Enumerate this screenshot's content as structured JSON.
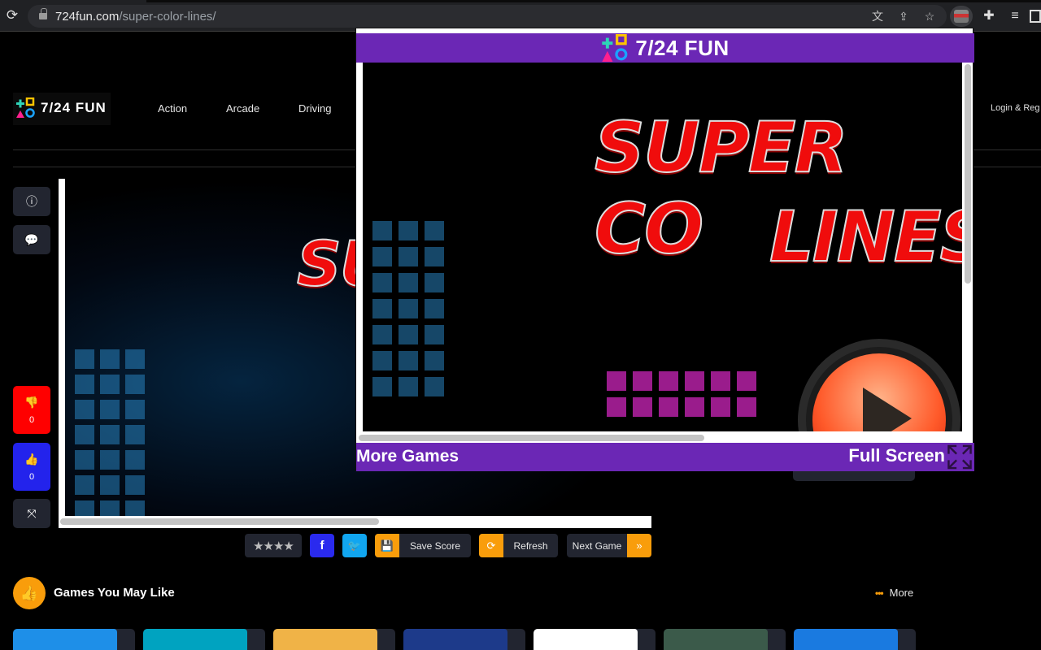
{
  "browser": {
    "url_host": "724fun.com",
    "url_path": "/super-color-lines/",
    "icons": [
      "reload-icon",
      "lock-icon",
      "translate-icon",
      "share-icon",
      "bookmark-star-icon",
      "extension-screenshot-icon",
      "extensions-puzzle-icon",
      "media-queue-icon"
    ]
  },
  "site": {
    "logo_text": "7/24 FUN",
    "nav": [
      "Action",
      "Arcade",
      "Driving"
    ],
    "login_label": "Login & Reg"
  },
  "side_actions": {
    "info_icon": "info-icon",
    "comment_icon": "comment-icon",
    "dislike_count": "0",
    "like_count": "0",
    "fullscreen_icon": "expand-icon",
    "dislike_color": "#ff0000",
    "like_color": "#2323ec"
  },
  "game": {
    "title_line1": "SUPER CO",
    "title_line2": "LINES",
    "bg_title_fragment": "SU"
  },
  "toolbar": {
    "rating_stars": "★★★★",
    "facebook_label": "f",
    "twitter_label": "🐦",
    "save_score_label": "Save Score",
    "refresh_label": "Refresh",
    "next_game_label": "Next Game",
    "next_icon": "»",
    "accent": "#f99d0b"
  },
  "popup": {
    "header_title": "7/24 FUN",
    "more_games_label": "More Games",
    "full_screen_label": "Full Screen",
    "purple": "#6b27b5"
  },
  "games_section": {
    "title": "Games You May Like",
    "more_label": "More",
    "cards": [
      {
        "color": "#1e8fe8"
      },
      {
        "color": "#00a3c0"
      },
      {
        "color": "#f0b347"
      },
      {
        "color": "#1d3a8a"
      },
      {
        "color": "#ffffff"
      },
      {
        "color": "#3b5a4a"
      },
      {
        "color": "#1a7ae0"
      }
    ]
  }
}
